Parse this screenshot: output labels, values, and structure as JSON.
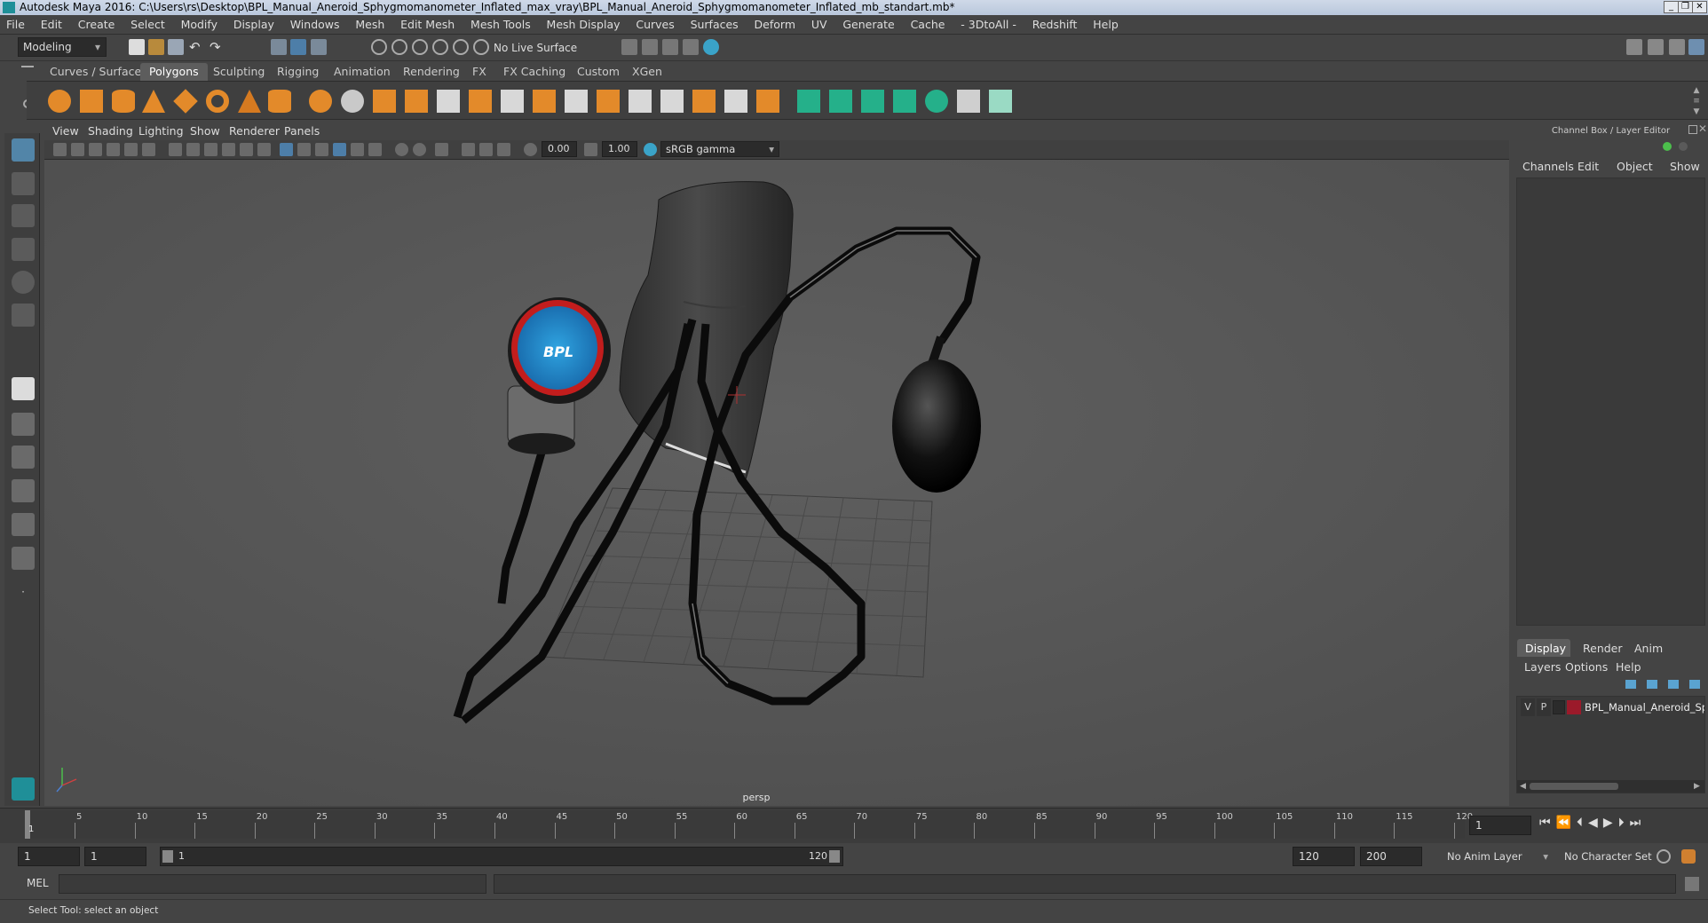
{
  "window": {
    "title": "Autodesk Maya 2016: C:\\Users\\rs\\Desktop\\BPL_Manual_Aneroid_Sphygmomanometer_Inflated_max_vray\\BPL_Manual_Aneroid_Sphygmomanometer_Inflated_mb_standart.mb*",
    "controls": [
      "_",
      "❐",
      "✕"
    ]
  },
  "menu": [
    "File",
    "Edit",
    "Create",
    "Select",
    "Modify",
    "Display",
    "Windows",
    "Mesh",
    "Edit Mesh",
    "Mesh Tools",
    "Mesh Display",
    "Curves",
    "Surfaces",
    "Deform",
    "UV",
    "Generate",
    "Cache",
    "- 3DtoAll -",
    "Redshift",
    "Help"
  ],
  "toolbar": {
    "mode": "Modeling",
    "live_surface": "No Live Surface"
  },
  "shelf": {
    "tabs": [
      "Curves / Surfaces",
      "Polygons",
      "Sculpting",
      "Rigging",
      "Animation",
      "Rendering",
      "FX",
      "FX Caching",
      "Custom",
      "XGen"
    ],
    "active_tab": "Polygons"
  },
  "viewport": {
    "menus": [
      "View",
      "Shading",
      "Lighting",
      "Show",
      "Renderer",
      "Panels"
    ],
    "exposure": "0.00",
    "gamma": "1.00",
    "color_space": "sRGB gamma",
    "camera_label": "persp",
    "gauge_brand": "BPL"
  },
  "channel_box": {
    "title": "Channel Box / Layer Editor",
    "menus": [
      "Channels",
      "Edit",
      "Object",
      "Show"
    ],
    "tabs": [
      "Display",
      "Render",
      "Anim"
    ],
    "active_tab": "Display",
    "layer_menus": [
      "Layers",
      "Options",
      "Help"
    ],
    "layer": {
      "v": "V",
      "p": "P",
      "name": "BPL_Manual_Aneroid_Sp",
      "color": "#9b1a2a"
    }
  },
  "timeline": {
    "ticks": [
      "5",
      "10",
      "15",
      "20",
      "25",
      "30",
      "35",
      "40",
      "45",
      "50",
      "55",
      "60",
      "65",
      "70",
      "75",
      "80",
      "85",
      "90",
      "95",
      "100",
      "105",
      "110",
      "115",
      "120"
    ],
    "first_label": "1",
    "current_frame": "1"
  },
  "range": {
    "start": "1",
    "playback_start": "1",
    "slider_start": "1",
    "slider_end": "120",
    "playback_end": "120",
    "end": "200",
    "anim_layer": "No Anim Layer",
    "character_set": "No Character Set"
  },
  "command": {
    "label": "MEL"
  },
  "help_line": "Select Tool: select an object"
}
